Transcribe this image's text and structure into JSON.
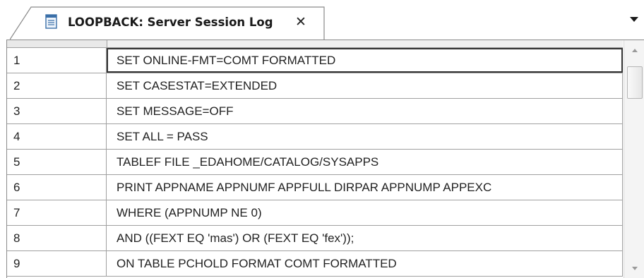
{
  "tab": {
    "title": "LOOPBACK: Server Session Log",
    "close_glyph": "✕",
    "icon": "document-icon",
    "menu_icon": "dropdown-triangle-icon"
  },
  "rows": [
    {
      "num": "1",
      "command": "SET ONLINE-FMT=COMT FORMATTED"
    },
    {
      "num": "2",
      "command": "SET CASESTAT=EXTENDED"
    },
    {
      "num": "3",
      "command": "SET MESSAGE=OFF"
    },
    {
      "num": "4",
      "command": "SET ALL = PASS"
    },
    {
      "num": "5",
      "command": "TABLEF FILE _EDAHOME/CATALOG/SYSAPPS"
    },
    {
      "num": "6",
      "command": "PRINT APPNAME APPNUMF APPFULL DIRPAR APPNUMP APPEXC"
    },
    {
      "num": "7",
      "command": "WHERE (APPNUMP NE 0)"
    },
    {
      "num": "8",
      "command": "AND ((FEXT EQ 'mas') OR (FEXT EQ 'fex'));"
    },
    {
      "num": "9",
      "command": "ON TABLE PCHOLD FORMAT COMT FORMATTED"
    }
  ],
  "selected_row": "1",
  "colors": {
    "grid_line": "#a0a0a0",
    "selection_outline": "#333333",
    "tab_border": "#8a8a8a"
  }
}
